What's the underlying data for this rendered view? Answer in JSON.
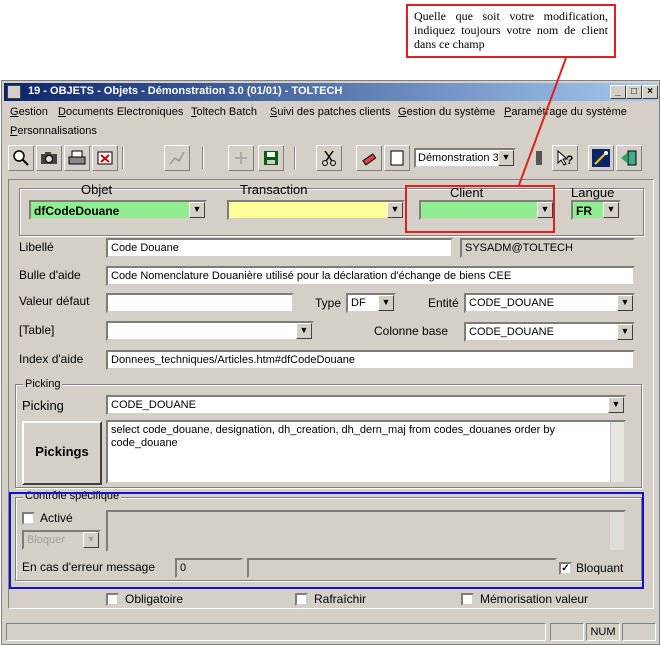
{
  "callout": {
    "text": "Quelle que soit votre modification, indiquez toujours votre nom de client dans ce champ"
  },
  "window": {
    "title": "19 - OBJETS - Objets - Démonstration 3.0 (01/01) - TOLTECH",
    "controls": [
      "minimize-icon",
      "maximize-icon",
      "close-icon"
    ]
  },
  "menu": {
    "items": [
      "Gestion",
      "Documents Electroniques",
      "Toltech Batch",
      "Suivi des patches clients",
      "Gestion du système",
      "Paramétrage du système",
      "Personnalisations"
    ]
  },
  "toolbar": {
    "db_select": "Démonstration 3",
    "icons": [
      "search-icon",
      "camera-icon",
      "print-icon",
      "export-icon",
      "chart-icon",
      "add-icon",
      "save-icon",
      "cut-icon",
      "erase-icon",
      "new-doc-icon",
      "help-icon",
      "wand-icon",
      "exit-icon"
    ]
  },
  "header": {
    "objet_label": "Objet",
    "objet_value": "dfCodeDouane",
    "transaction_label": "Transaction",
    "transaction_value": "",
    "client_label": "Client",
    "client_value": "",
    "langue_label": "Langue",
    "langue_value": "FR"
  },
  "form": {
    "libelle_label": "Libellé",
    "libelle_value": "Code Douane",
    "user_value": "SYSADM@TOLTECH",
    "bulle_label": "Bulle d'aide",
    "bulle_value": "Code Nomenclature Douanière utilisé pour la déclaration d'échange de biens CEE",
    "valeur_label": "Valeur défaut",
    "valeur_value": "",
    "type_label": "Type",
    "type_value": "DF",
    "entite_label": "Entité",
    "entite_value": "CODE_DOUANE",
    "table_label": "[Table]",
    "table_value": "",
    "colonne_label": "Colonne base",
    "colonne_value": "CODE_DOUANE",
    "index_label": "Index d'aide",
    "index_value": "Donnees_techniques/Articles.htm#dfCodeDouane"
  },
  "picking": {
    "group_title": "Picking",
    "label": "Picking",
    "value": "CODE_DOUANE",
    "button": "Pickings",
    "sql": "select code_douane, designation, dh_creation, dh_dern_maj from codes_douanes order by code_douane"
  },
  "controle": {
    "group_title": "Contrôle spécifique",
    "active_label": "Activé",
    "mode_value": "Bloquer",
    "erreur_label": "En cas d'erreur message",
    "erreur_value": "0",
    "bloquant_label": "Bloquant"
  },
  "footer": {
    "obligatoire_label": "Obligatoire",
    "rafraichir_label": "Rafraîchir",
    "memorisation_label": "Mémorisation valeur"
  },
  "status": {
    "num": "NUM"
  }
}
